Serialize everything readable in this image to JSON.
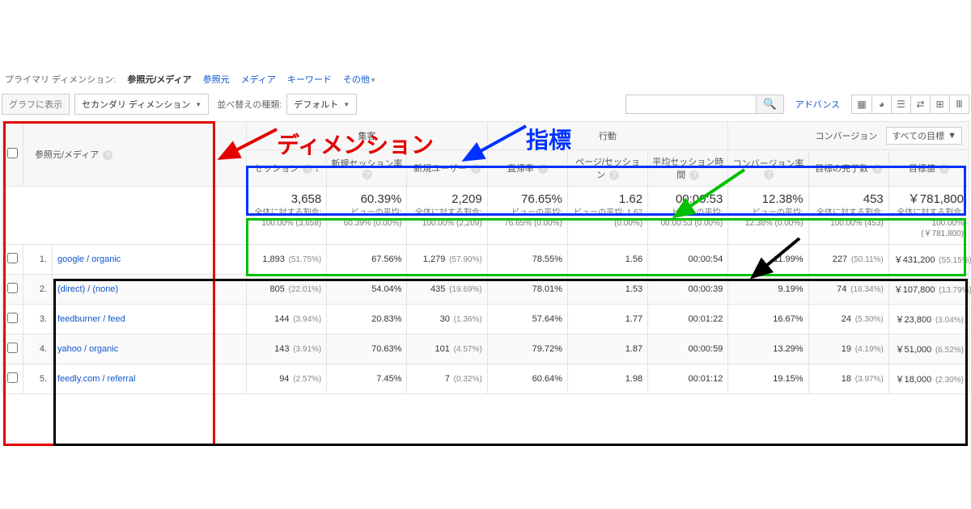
{
  "dimRow": {
    "label": "プライマリ ディメンション:",
    "active": "参照元/メディア",
    "links": [
      "参照元",
      "メディア",
      "キーワード",
      "その他"
    ]
  },
  "toolbar": {
    "chartBtn": "グラフに表示",
    "secondaryDim": "セカンダリ ディメンション",
    "sortLabel": "並べ替えの種類:",
    "sortDefault": "デフォルト",
    "advance": "アドバンス"
  },
  "headers": {
    "dimension": "参照元/メディア",
    "group1": "集客",
    "group2": "行動",
    "group3": "コンバージョン",
    "convDropdown": "すべての目標",
    "cols": [
      "セッション",
      "新規セッション率",
      "新規ユーザー",
      "直帰率",
      "ページ/セッション",
      "平均セッション時間",
      "コンバージョン率",
      "目標の完了数",
      "目標値"
    ]
  },
  "summary": [
    {
      "big": "3,658",
      "sub": "全体に対する割合: 100.00% (3,658)"
    },
    {
      "big": "60.39%",
      "sub": "ビューの平均: 60.39% (0.00%)"
    },
    {
      "big": "2,209",
      "sub": "全体に対する割合: 100.00% (2,209)"
    },
    {
      "big": "76.65%",
      "sub": "ビューの平均: 76.65% (0.00%)"
    },
    {
      "big": "1.62",
      "sub": "ビューの平均: 1.62 (0.00%)"
    },
    {
      "big": "00:00:53",
      "sub": "ビューの平均: 00:00:53 (0.00%)"
    },
    {
      "big": "12.38%",
      "sub": "ビューの平均: 12.38% (0.00%)"
    },
    {
      "big": "453",
      "sub": "全体に対する割合: 100.00% (453)"
    },
    {
      "big": "￥781,800",
      "sub": "全体に対する割合: 100.00% (￥781,800)"
    }
  ],
  "rows": [
    {
      "n": "1.",
      "name": "google / organic",
      "cells": [
        "1,893",
        "(51.75%)",
        "67.56%",
        "",
        "1,279",
        "(57.90%)",
        "78.55%",
        "",
        "1.56",
        "",
        "00:00:54",
        "",
        "11.99%",
        "",
        "227",
        "(50.11%)",
        "￥431,200",
        "(55.15%)"
      ]
    },
    {
      "n": "2.",
      "name": "(direct) / (none)",
      "cells": [
        "805",
        "(22.01%)",
        "54.04%",
        "",
        "435",
        "(19.69%)",
        "78.01%",
        "",
        "1.53",
        "",
        "00:00:39",
        "",
        "9.19%",
        "",
        "74",
        "(16.34%)",
        "￥107,800",
        "(13.79%)"
      ]
    },
    {
      "n": "3.",
      "name": "feedburner / feed",
      "cells": [
        "144",
        "(3.94%)",
        "20.83%",
        "",
        "30",
        "(1.36%)",
        "57.64%",
        "",
        "1.77",
        "",
        "00:01:22",
        "",
        "16.67%",
        "",
        "24",
        "(5.30%)",
        "￥23,800",
        "(3.04%)"
      ]
    },
    {
      "n": "4.",
      "name": "yahoo / organic",
      "cells": [
        "143",
        "(3.91%)",
        "70.63%",
        "",
        "101",
        "(4.57%)",
        "79.72%",
        "",
        "1.87",
        "",
        "00:00:59",
        "",
        "13.29%",
        "",
        "19",
        "(4.19%)",
        "￥51,000",
        "(6.52%)"
      ]
    },
    {
      "n": "5.",
      "name": "feedly.com / referral",
      "cells": [
        "94",
        "(2.57%)",
        "7.45%",
        "",
        "7",
        "(0.32%)",
        "60.64%",
        "",
        "1.98",
        "",
        "00:01:12",
        "",
        "19.15%",
        "",
        "18",
        "(3.97%)",
        "￥18,000",
        "(2.30%)"
      ]
    }
  ],
  "annotations": {
    "dimension": "ディメンション",
    "metric": "指標"
  }
}
